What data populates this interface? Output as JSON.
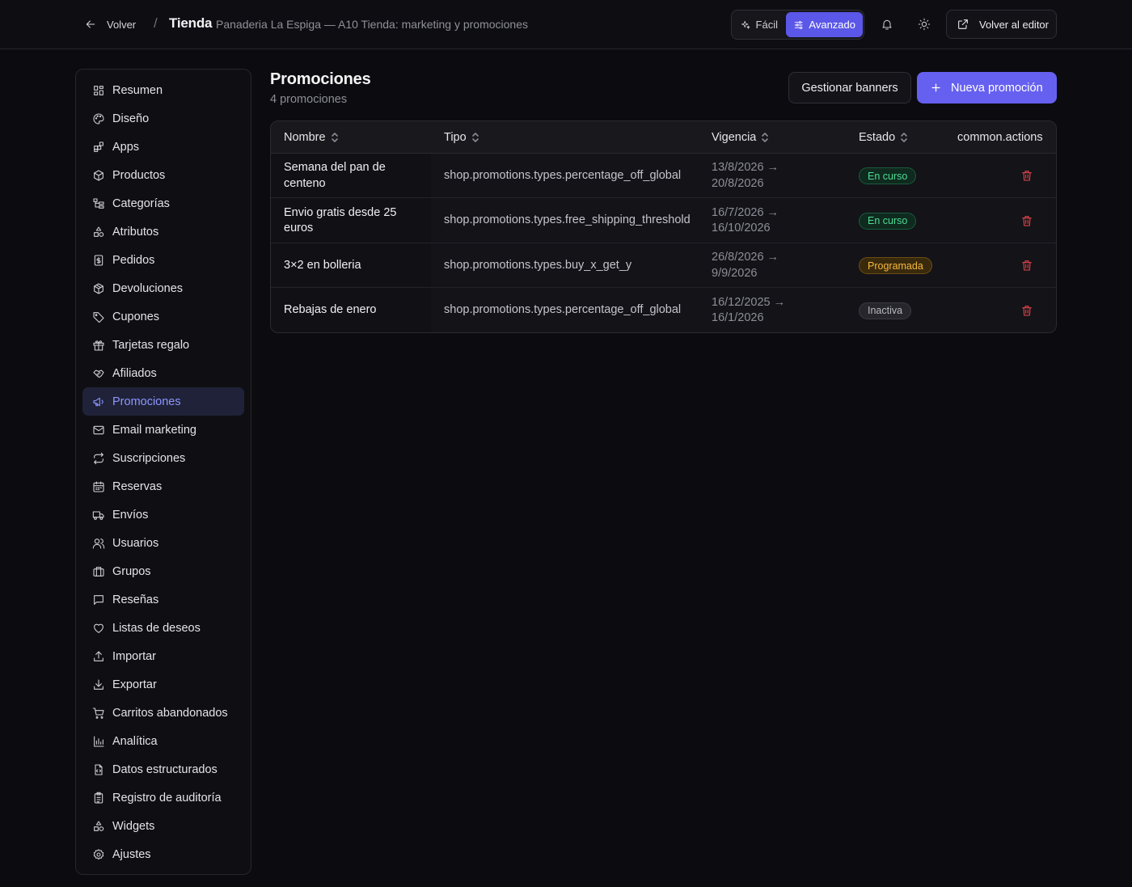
{
  "header": {
    "back_label": "Volver",
    "separator": "/",
    "title": "Tienda",
    "subtitle": "Panaderia La Espiga — A10 Tienda: marketing y promociones",
    "mode_easy": "Fácil",
    "mode_advanced": "Avanzado",
    "mode_selected": "Avanzado",
    "editor_label": "Volver al editor"
  },
  "sidebar": {
    "active": "Promociones",
    "items": [
      {
        "label": "Resumen",
        "icon": "grid-icon"
      },
      {
        "label": "Diseño",
        "icon": "palette-icon"
      },
      {
        "label": "Apps",
        "icon": "apps-icon"
      },
      {
        "label": "Productos",
        "icon": "box-icon"
      },
      {
        "label": "Categorías",
        "icon": "category-tree-icon"
      },
      {
        "label": "Atributos",
        "icon": "shapes-icon"
      },
      {
        "label": "Pedidos",
        "icon": "receipt-icon"
      },
      {
        "label": "Devoluciones",
        "icon": "return-box-icon"
      },
      {
        "label": "Cupones",
        "icon": "tag-icon"
      },
      {
        "label": "Tarjetas regalo",
        "icon": "gift-icon"
      },
      {
        "label": "Afiliados",
        "icon": "handshake-icon"
      },
      {
        "label": "Promociones",
        "icon": "megaphone-icon"
      },
      {
        "label": "Email marketing",
        "icon": "mail-icon"
      },
      {
        "label": "Suscripciones",
        "icon": "repeat-icon"
      },
      {
        "label": "Reservas",
        "icon": "calendar-icon"
      },
      {
        "label": "Envíos",
        "icon": "truck-icon"
      },
      {
        "label": "Usuarios",
        "icon": "users-icon"
      },
      {
        "label": "Grupos",
        "icon": "groups-icon"
      },
      {
        "label": "Reseñas",
        "icon": "message-square-icon"
      },
      {
        "label": "Listas de deseos",
        "icon": "heart-icon"
      },
      {
        "label": "Importar",
        "icon": "upload-icon"
      },
      {
        "label": "Exportar",
        "icon": "download-icon"
      },
      {
        "label": "Carritos abandonados",
        "icon": "cart-icon"
      },
      {
        "label": "Analítica",
        "icon": "bar-chart-icon"
      },
      {
        "label": "Datos estructurados",
        "icon": "file-code-icon"
      },
      {
        "label": "Registro de auditoría",
        "icon": "clipboard-list-icon"
      },
      {
        "label": "Widgets",
        "icon": "shapes-icon"
      },
      {
        "label": "Ajustes",
        "icon": "gear-icon"
      }
    ]
  },
  "main": {
    "title": "Promociones",
    "count": "4 promociones",
    "banners_button": "Gestionar banners",
    "new_button": "Nueva promoción",
    "table": {
      "columns": [
        "Nombre",
        "Tipo",
        "Vigencia",
        "Estado",
        "common.actions"
      ],
      "rows": [
        {
          "name": "Semana del pan de centeno",
          "type": "shop.promotions.types.percentage_off_global",
          "range": "13/8/2026 → 20/8/2026",
          "status": "En curso",
          "status_kind": "curso"
        },
        {
          "name": "Envio gratis desde 25 euros",
          "type": "shop.promotions.types.free_shipping_threshold",
          "range": "16/7/2026 → 16/10/2026",
          "status": "En curso",
          "status_kind": "curso"
        },
        {
          "name": "3×2 en bolleria",
          "type": "shop.promotions.types.buy_x_get_y",
          "range": "26/8/2026 → 9/9/2026",
          "status": "Programada",
          "status_kind": "prog"
        },
        {
          "name": "Rebajas de enero",
          "type": "shop.promotions.types.percentage_off_global",
          "range": "16/12/2025 → 16/1/2026",
          "status": "Inactiva",
          "status_kind": "inact"
        }
      ]
    }
  },
  "colors": {
    "accent": "#6660f0",
    "active_nav_text": "#8e96ff",
    "status_running": "#4fdc95",
    "status_scheduled": "#f5b93a",
    "status_inactive": "#b8b8c0",
    "danger": "#e5484d"
  }
}
